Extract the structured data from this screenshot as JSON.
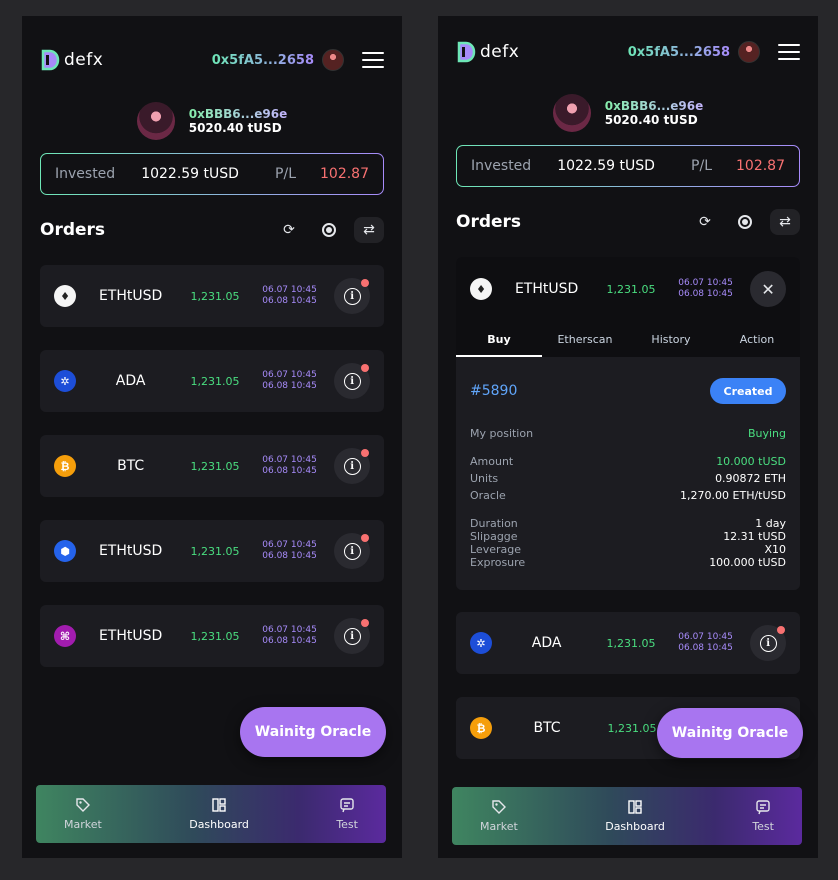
{
  "app": {
    "name": "defx"
  },
  "header": {
    "address": "0x5fA5...2658"
  },
  "profile": {
    "address": "0xBBB6...e96e",
    "balance": "5020.40 tUSD"
  },
  "summary": {
    "invested_label": "Invested",
    "invested_value": "1022.59 tUSD",
    "pl_label": "P/L",
    "pl_value": "102.87"
  },
  "orders": {
    "title": "Orders",
    "left": [
      {
        "pair": "ETHtUSD",
        "price": "1,231.05",
        "date1": "06.07 10:45",
        "date2": "06.08 10:45",
        "icon": "eth-icon"
      },
      {
        "pair": "ADA",
        "price": "1,231.05",
        "date1": "06.07 10:45",
        "date2": "06.08 10:45",
        "icon": "ada-icon"
      },
      {
        "pair": "BTC",
        "price": "1,231.05",
        "date1": "06.07 10:45",
        "date2": "06.08 10:45",
        "icon": "btc-icon"
      },
      {
        "pair": "ETHtUSD",
        "price": "1,231.05",
        "date1": "06.07 10:45",
        "date2": "06.08 10:45",
        "icon": "cube-icon"
      },
      {
        "pair": "ETHtUSD",
        "price": "1,231.05",
        "date1": "06.07 10:45",
        "date2": "06.08 10:45",
        "icon": "polygon-icon"
      }
    ],
    "right": [
      {
        "pair": "ADA",
        "price": "1,231.05",
        "date1": "06.07 10:45",
        "date2": "06.08 10:45",
        "icon": "ada-icon"
      },
      {
        "pair": "BTC",
        "price": "1,231.05",
        "icon": "btc-icon"
      }
    ]
  },
  "expanded": {
    "pair": "ETHtUSD",
    "price": "1,231.05",
    "date1": "06.07 10:45",
    "date2": "06.08 10:45",
    "tabs": [
      "Buy",
      "Etherscan",
      "History",
      "Action"
    ],
    "order_id": "#5890",
    "status": "Created",
    "position_label": "My position",
    "position_value": "Buying",
    "details_a": [
      {
        "k": "Amount",
        "v": "10.000 tUSD"
      },
      {
        "k": "Units",
        "v": "0.90872 ETH"
      },
      {
        "k": "Oracle",
        "v": "1,270.00 ETH/tUSD"
      }
    ],
    "details_b": [
      {
        "k": "Duration",
        "v": "1 day"
      },
      {
        "k": "Slipagge",
        "v": "12.31 tUSD"
      },
      {
        "k": "Leverage",
        "v": "X10"
      },
      {
        "k": "Exprosure",
        "v": "100.000 tUSD"
      }
    ]
  },
  "fab": {
    "label": "Wainitg Oracle"
  },
  "nav": {
    "market": "Market",
    "dashboard": "Dashboard",
    "test": "Test"
  },
  "colors": {
    "accent_green": "#4ade80",
    "accent_purple": "#a78bfa",
    "loss_red": "#f87171",
    "fab": "#a875f0",
    "badge_blue": "#3b82f6"
  }
}
